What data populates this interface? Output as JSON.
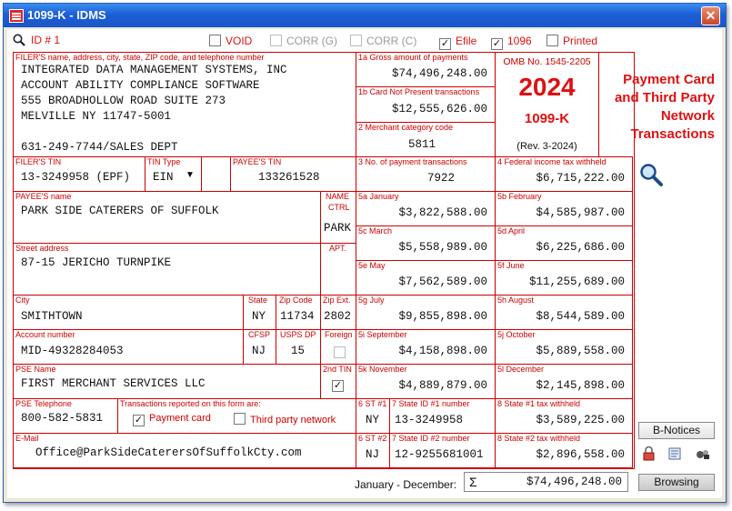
{
  "window": {
    "title": "1099-K - IDMS"
  },
  "toolbar": {
    "id_label": "ID # 1",
    "void": "VOID",
    "corr_g": "CORR (G)",
    "corr_c": "CORR (C)",
    "efile": "Efile",
    "form1096": "1096",
    "printed": "Printed"
  },
  "filer": {
    "label": "FILER'S name, address, city, state, ZIP code, and telephone number",
    "line1": "INTEGRATED DATA MANAGEMENT SYSTEMS, INC",
    "line2": "ACCOUNT ABILITY COMPLIANCE SOFTWARE",
    "line3": "555 BROADHOLLOW ROAD SUITE 273",
    "line4": "MELVILLE NY 11747-5001",
    "phone": "631-249-7744/SALES DEPT"
  },
  "box1a": {
    "label": "1a Gross amount of payments",
    "value": "$74,496,248.00"
  },
  "box1b": {
    "label": "1b Card Not Present transactions",
    "value": "$12,555,626.00"
  },
  "box2": {
    "label": "2 Merchant category code",
    "value": "5811"
  },
  "omb": {
    "number": "OMB No. 1545-2205",
    "year": "2024",
    "form": "1099-K",
    "rev": "(Rev. 3-2024)"
  },
  "side_title": {
    "l1": "Payment Card",
    "l2": "and Third Party",
    "l3": "Network",
    "l4": "Transactions"
  },
  "filer_tin": {
    "label": "FILER'S TIN",
    "value": "13-3249958 (EPF)"
  },
  "tin_type": {
    "label": "TIN Type",
    "value": "EIN"
  },
  "payee_tin": {
    "label": "PAYEE'S TIN",
    "value": "133261528"
  },
  "box3": {
    "label": "3 No. of payment transactions",
    "value": "7922"
  },
  "box4": {
    "label": "4 Federal income tax withheld",
    "value": "$6,715,222.00"
  },
  "payee": {
    "label": "PAYEE'S name",
    "value": "PARK SIDE CATERERS OF SUFFOLK",
    "ctrl_label1": "NAME",
    "ctrl_label2": "CTRL",
    "ctrl_value": "PARK"
  },
  "street": {
    "label": "Street address",
    "value": "87-15 JERICHO TURNPIKE",
    "apt_label": "APT."
  },
  "months": {
    "jan": {
      "label": "5a January",
      "value": "$3,822,588.00"
    },
    "feb": {
      "label": "5b February",
      "value": "$4,585,987.00"
    },
    "mar": {
      "label": "5c March",
      "value": "$5,558,989.00"
    },
    "apr": {
      "label": "5d April",
      "value": "$6,225,686.00"
    },
    "may": {
      "label": "5e May",
      "value": "$7,562,589.00"
    },
    "jun": {
      "label": "5f June",
      "value": "$11,255,689.00"
    },
    "jul": {
      "label": "5g July",
      "value": "$9,855,898.00"
    },
    "aug": {
      "label": "5h August",
      "value": "$8,544,589.00"
    },
    "sep": {
      "label": "5i September",
      "value": "$4,158,898.00"
    },
    "oct": {
      "label": "5j October",
      "value": "$5,889,558.00"
    },
    "nov": {
      "label": "5k November",
      "value": "$4,889,879.00"
    },
    "dec": {
      "label": "5l December",
      "value": "$2,145,898.00"
    }
  },
  "city": {
    "label": "City",
    "value": "SMITHTOWN",
    "state_label": "State",
    "state": "NY",
    "zip_label": "Zip Code",
    "zip": "11734",
    "zipext_label": "Zip Ext.",
    "zipext": "2802"
  },
  "account": {
    "label": "Account number",
    "value": "MID-49328284053",
    "cfsp_label": "CFSP",
    "cfsp": "NJ",
    "uspsdp_label": "USPS DP",
    "uspsdp": "15",
    "foreign_label": "Foreign"
  },
  "pse": {
    "label": "PSE Name",
    "value": "FIRST MERCHANT SERVICES LLC",
    "tin2_label": "2nd TIN",
    "tel_label": "PSE Telephone",
    "tel": "800-582-5831",
    "trans_label": "Transactions reported on this form are:",
    "payment_card": "Payment card",
    "third_party": "Third party network"
  },
  "state1": {
    "st_label": "6 ST #1",
    "st": "NY",
    "id_label": "7 State ID #1 number",
    "id": "13-3249958",
    "tax_label": "8 State #1 tax withheld",
    "tax": "$3,589,225.00"
  },
  "state2": {
    "st_label": "6 ST #2",
    "st": "NJ",
    "id_label": "7 State ID #2 number",
    "id": "12-9255681001",
    "tax_label": "8 State #2 tax withheld",
    "tax": "$2,896,558.00"
  },
  "email": {
    "label": "E-Mail",
    "value": "Office@ParkSideCaterersOfSuffolkCty.com"
  },
  "footer": {
    "period": "January - December:",
    "sigma": "Σ",
    "total": "$74,496,248.00",
    "browsing": "Browsing",
    "bnotices": "B-Notices"
  }
}
